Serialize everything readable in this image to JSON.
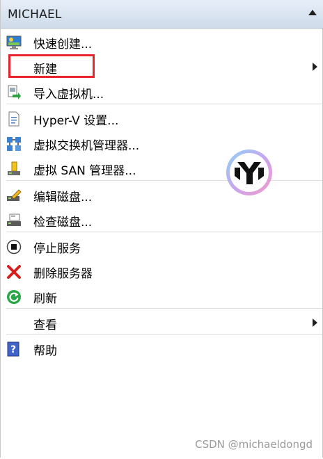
{
  "header": {
    "title": "MICHAEL"
  },
  "menu": [
    {
      "label": "快速创建...",
      "icon": "monitor-icon"
    },
    {
      "label": "新建",
      "has_submenu": true
    },
    {
      "label": "导入虚拟机...",
      "icon": "import-vm-icon"
    },
    {
      "label": "Hyper-V 设置...",
      "icon": "document-settings-icon"
    },
    {
      "label": "虚拟交换机管理器...",
      "icon": "network-switch-icon"
    },
    {
      "label": "虚拟 SAN 管理器...",
      "icon": "san-icon"
    },
    {
      "label": "编辑磁盘...",
      "icon": "edit-disk-icon"
    },
    {
      "label": "检查磁盘...",
      "icon": "inspect-disk-icon"
    },
    {
      "label": "停止服务",
      "icon": "stop-icon"
    },
    {
      "label": "删除服务器",
      "icon": "delete-icon"
    },
    {
      "label": "刷新",
      "icon": "refresh-icon"
    },
    {
      "label": "查看",
      "has_submenu": true
    },
    {
      "label": "帮助",
      "icon": "help-icon"
    }
  ],
  "watermark": "CSDN @michaeldongd",
  "colors": {
    "header_top": "#e6eef8",
    "header_bottom": "#cfdbea",
    "highlight_border": "#e8232c",
    "separator": "#dcdcdc"
  }
}
